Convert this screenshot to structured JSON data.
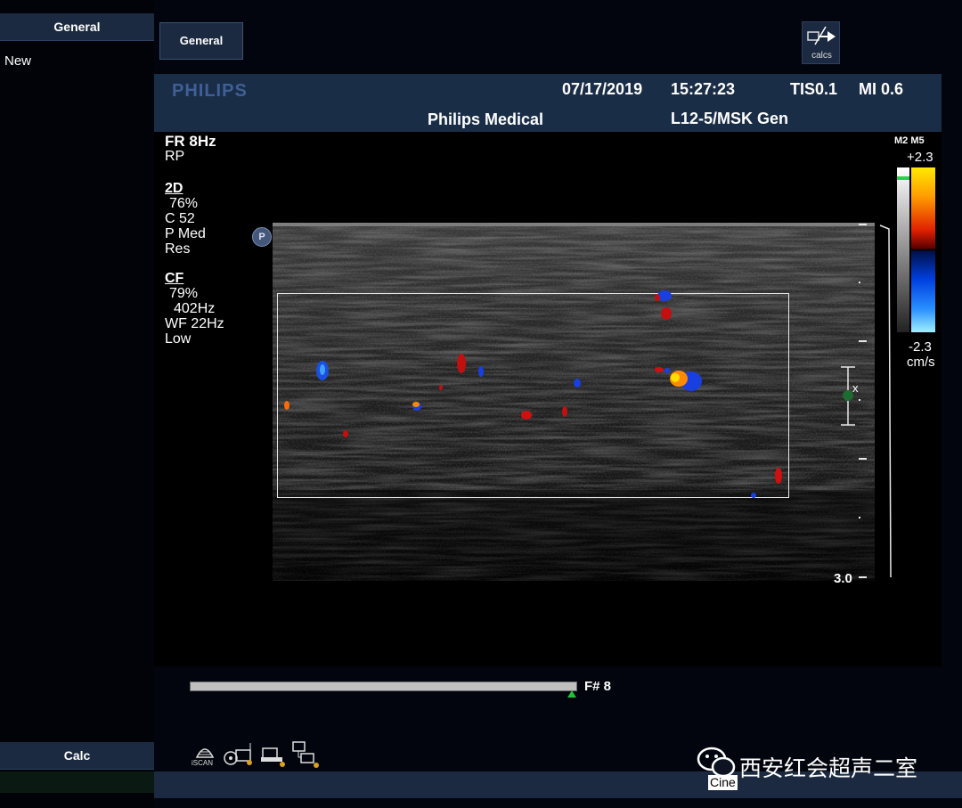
{
  "sidebar": {
    "top_header": "General",
    "items": [
      {
        "label": "New"
      }
    ],
    "bottom_header": "Calc"
  },
  "toolbar": {
    "general_label": "General",
    "calcs_label": "calcs"
  },
  "header": {
    "logo": "PHILIPS",
    "date": "07/17/2019",
    "time": "15:27:23",
    "tis": "TIS0.1",
    "mi": "MI 0.6",
    "institution": "Philips Medical",
    "probe_preset": "L12-5/MSK Gen"
  },
  "params": {
    "fr": "FR 8Hz",
    "rp": "RP",
    "mode2d": {
      "title": "2D",
      "gain": "76%",
      "compression": "C 52",
      "persistence": "P Med",
      "res": "Res"
    },
    "cf": {
      "title": "CF",
      "gain": "79%",
      "prf": "402Hz",
      "wf": "WF  22Hz",
      "level": "Low"
    }
  },
  "probe_marker": "P",
  "color_scale": {
    "map": "M2 M5",
    "max": "+2.3",
    "min": "-2.3",
    "unit": "cm/s",
    "colors": {
      "positive_high": "#ffea00",
      "positive_low": "#e02000",
      "negative_low": "#0040e0",
      "negative_high": "#9ef0ff"
    }
  },
  "depth": {
    "label": "3.0",
    "focus_label": "x"
  },
  "cine": {
    "frame": "F#  8",
    "marker_color": "#22c03a",
    "position": 0.99
  },
  "bottom_icons": [
    {
      "name": "iscan-icon",
      "label": "iSCAN"
    },
    {
      "name": "transducer-icon"
    },
    {
      "name": "printer-icon"
    },
    {
      "name": "network-icon"
    }
  ],
  "watermark": {
    "text": "西安红会超声二室",
    "badge": "Cine"
  }
}
